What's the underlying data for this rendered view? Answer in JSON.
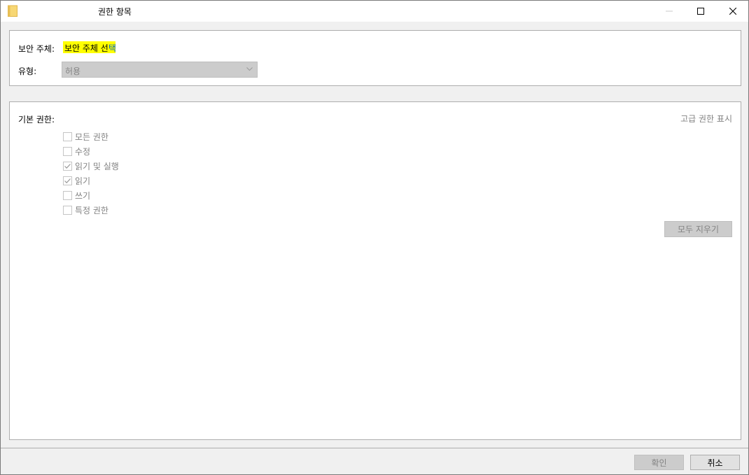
{
  "window": {
    "title": "권한 항목",
    "controls": {
      "minimize": "minimize-icon",
      "maximize": "maximize-icon",
      "close": "close-icon"
    }
  },
  "principal": {
    "label": "보안 주체:",
    "link_highlighted": "보안 주체 선",
    "link_tail": "택",
    "highlight_color": "#ffff00",
    "link_color": "#0066cc"
  },
  "type": {
    "label": "유형:",
    "value": "허용"
  },
  "basic_permissions": {
    "label": "기본 권한:",
    "advanced_link": "고급 권한 표시",
    "items": [
      {
        "label": "모든 권한",
        "checked": false
      },
      {
        "label": "수정",
        "checked": false
      },
      {
        "label": "읽기 및 실행",
        "checked": true
      },
      {
        "label": "읽기",
        "checked": true
      },
      {
        "label": "쓰기",
        "checked": false
      },
      {
        "label": "특정 권한",
        "checked": false
      }
    ],
    "clear_all": "모두 지우기"
  },
  "footer": {
    "ok": "확인",
    "cancel": "취소"
  }
}
